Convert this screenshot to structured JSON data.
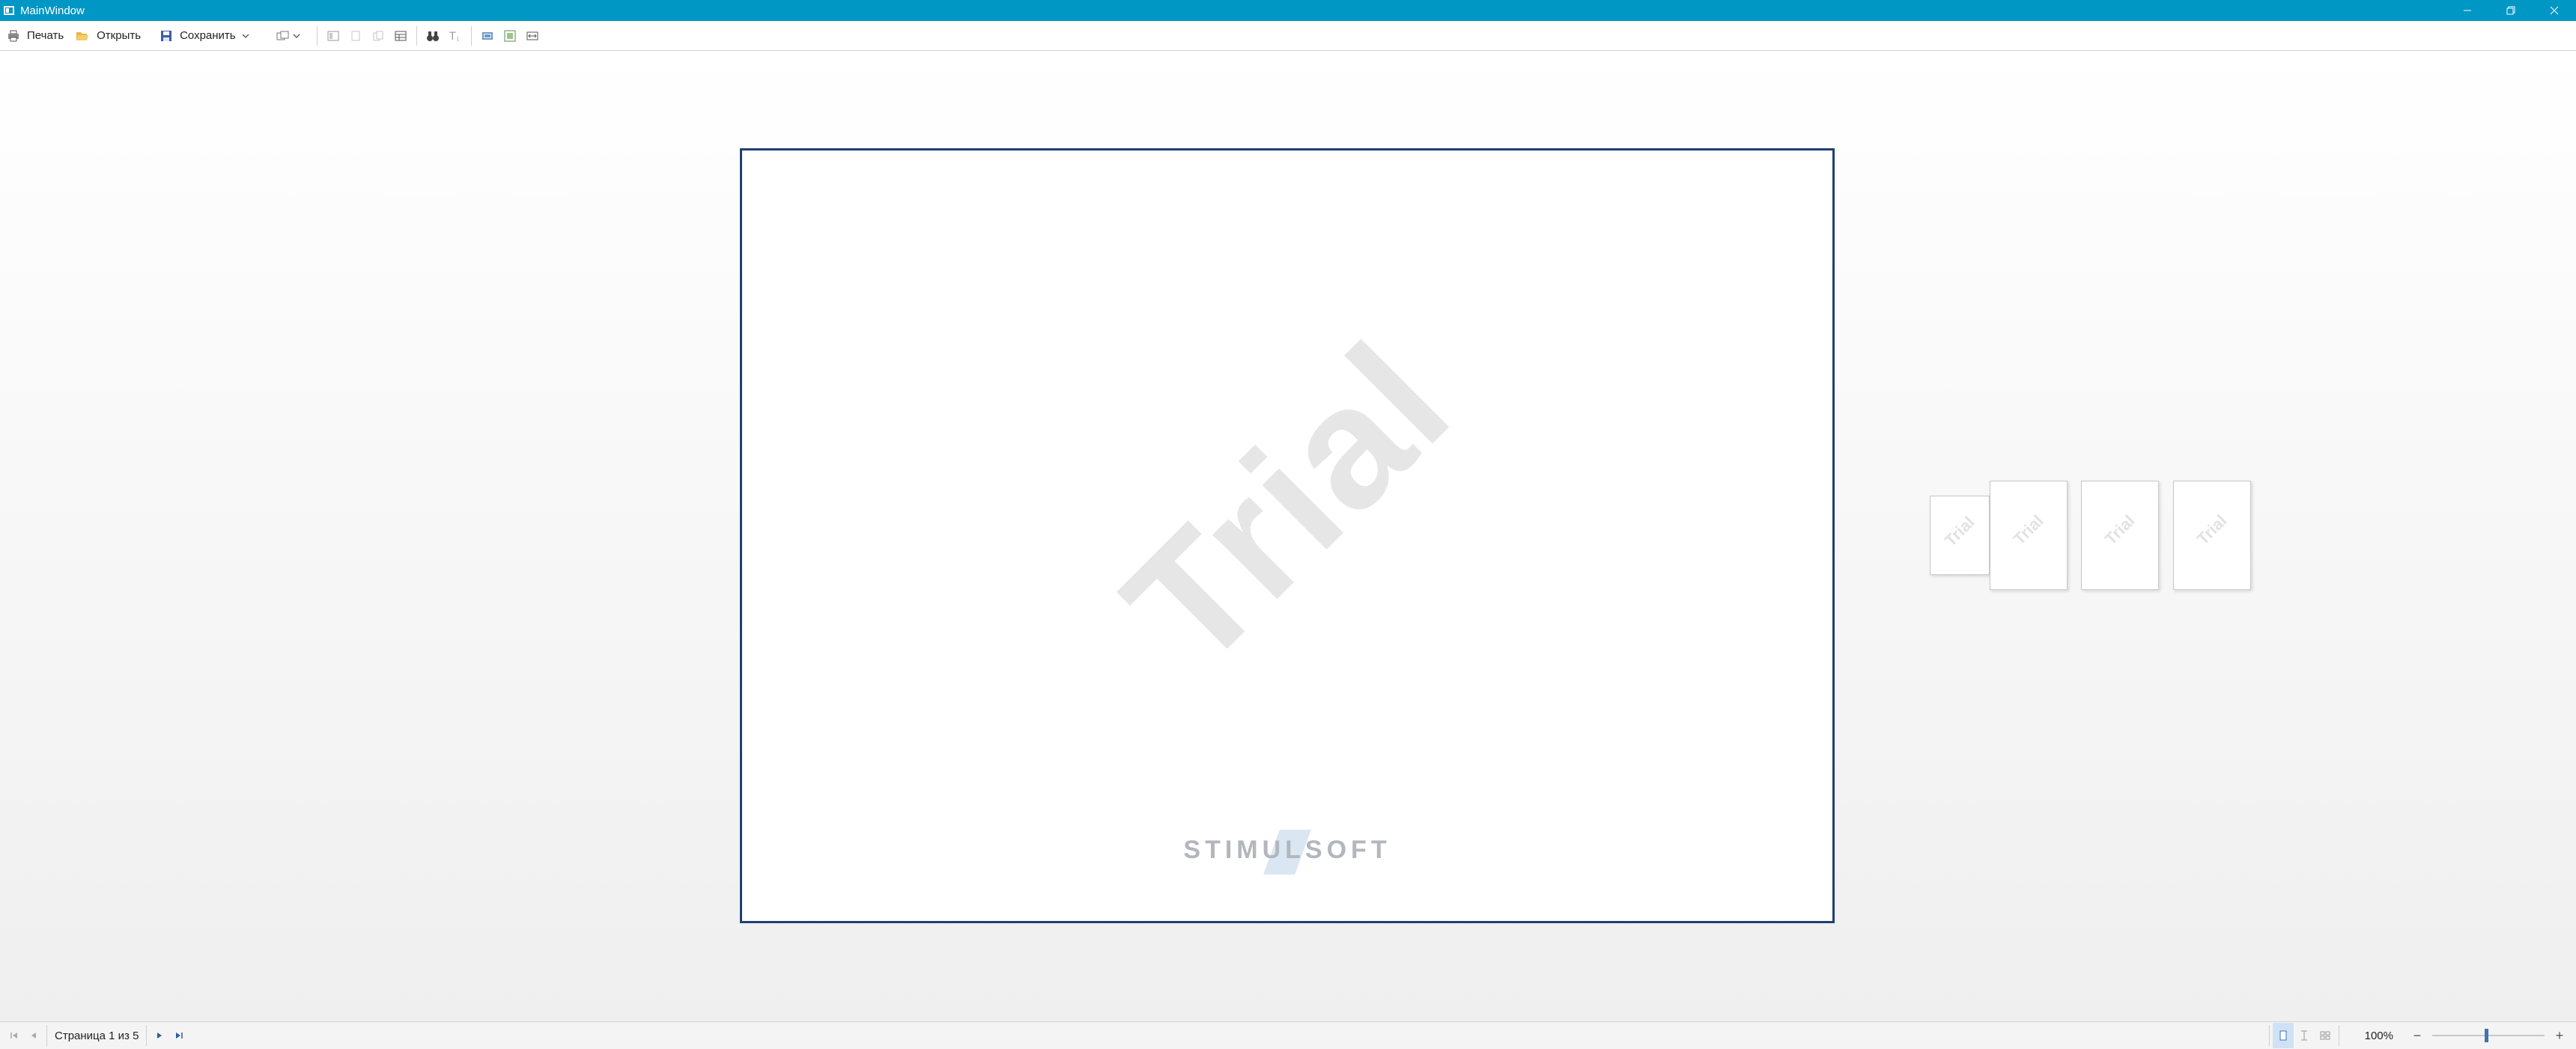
{
  "window": {
    "title": "MainWindow"
  },
  "toolbar": {
    "print_label": "Печать",
    "open_label": "Открыть",
    "save_label": "Сохранить"
  },
  "page": {
    "watermark": "Trial",
    "logo": "STIMULSOFT"
  },
  "thumbnails": [
    {
      "watermark": "Trial"
    },
    {
      "watermark": "Trial"
    },
    {
      "watermark": "Trial"
    },
    {
      "watermark": "Trial"
    }
  ],
  "statusbar": {
    "page_info": "Страница 1 из 5",
    "zoom": "100%"
  },
  "colors": {
    "titlebar": "#0097c4",
    "page_border": "#203f74",
    "accent": "#3f73b8"
  }
}
